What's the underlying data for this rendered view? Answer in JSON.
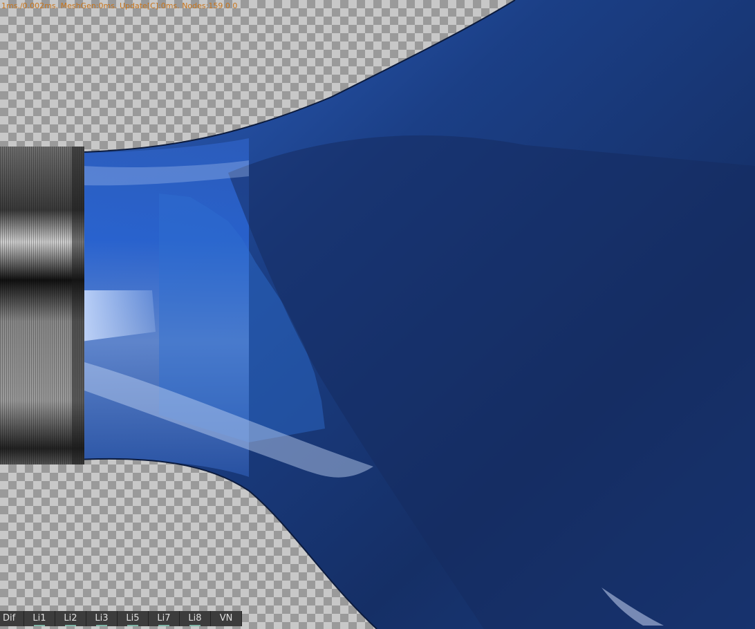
{
  "stats_text": "1ms./0.002ms. MeshGen:0ms. Update[C]:0ms. Nodes:159  0 0",
  "channels": [
    "Dif",
    "Li1",
    "Li2",
    "Li3",
    "Li5",
    "Li7",
    "Li8",
    "VN"
  ],
  "colors": {
    "stats_text": "#c8741a",
    "tube_blue_dark": "#132a5c",
    "tube_blue_mid": "#1f4f9e",
    "tube_blue_light": "#4a86e0",
    "cap_dark": "#1a1a1a",
    "cap_light": "#8f8f8f",
    "button_bg": "#3c3c3c"
  }
}
